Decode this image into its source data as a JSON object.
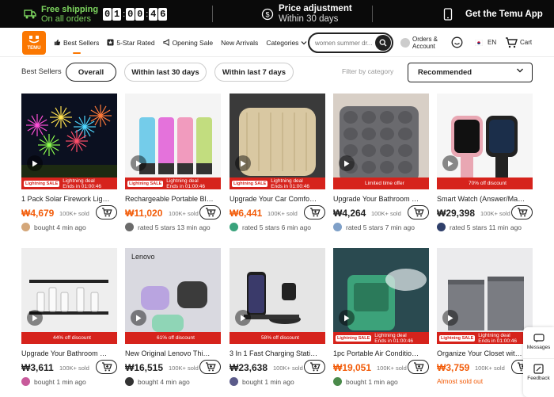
{
  "promo": {
    "shipping_title": "Free shipping",
    "shipping_sub": "On all orders",
    "timer": [
      "0",
      "1",
      "0",
      "0",
      "4",
      "6"
    ],
    "price_title": "Price adjustment",
    "price_sub": "Within 30 days",
    "app_label": "Get the Temu App"
  },
  "header": {
    "logo_text": "TEMU",
    "nav": [
      {
        "label": "Best Sellers",
        "icon": "thumbs-up-icon"
      },
      {
        "label": "5-Star Rated",
        "icon": "star-badge-icon"
      },
      {
        "label": "Opening Sale",
        "icon": "megaphone-icon"
      },
      {
        "label": "New Arrivals",
        "icon": ""
      },
      {
        "label": "Categories",
        "icon": "chevron-down-icon"
      }
    ],
    "search_placeholder": "women summer dr...",
    "orders_line1": "Orders &",
    "orders_line2": "Account",
    "lang": "EN",
    "cart": "Cart"
  },
  "filters": {
    "label": "Best Sellers",
    "options": [
      "Overall",
      "Within last 30 days",
      "Within last 7 days"
    ],
    "selected": "Overall",
    "category_label": "Filter by category",
    "sort": "Recommended"
  },
  "colors": {
    "accent": "#fb7701",
    "price": "#f25b08",
    "badge": "#d6231c"
  },
  "products": [
    {
      "title": "1 Pack Solar Firework Light ...",
      "price": "₩4,679",
      "sold": "100K+ sold",
      "badge_type": "lightning",
      "badge_line1": "Lightning deal",
      "badge_line2": "Ends in 01:00:46",
      "social": "bought 4 min ago",
      "img": "firework"
    },
    {
      "title": "Rechargeable Portable Blen...",
      "price": "₩11,020",
      "sold": "100K+ sold",
      "badge_type": "lightning",
      "badge_line1": "Lightning deal",
      "badge_line2": "Ends in 01:00:46",
      "social": "rated 5 stars 13 min ago",
      "img": "blender"
    },
    {
      "title": "Upgrade Your Car Comfort:...",
      "price": "₩6,441",
      "sold": "100K+ sold",
      "badge_type": "lightning",
      "badge_line1": "Lightning deal",
      "badge_line2": "Ends in 01:00:46",
      "social": "rated 5 stars 6 min ago",
      "img": "cushion"
    },
    {
      "title": "Upgrade Your Bathroom wit...",
      "price": "₩4,264",
      "sold": "100K+ sold",
      "badge_type": "plain",
      "badge_line1": "Limited time offer",
      "badge_line2": "",
      "social": "rated 5 stars 7 min ago",
      "img": "bathmat"
    },
    {
      "title": "Smart Watch (Answer/Make...",
      "price": "₩29,398",
      "sold": "100K+ sold",
      "badge_type": "plain",
      "badge_line1": "70% off discount",
      "badge_line2": "",
      "social": "rated 5 stars 11 min ago",
      "img": "watch"
    },
    {
      "title": "Upgrade Your Bathroom wit...",
      "price": "₩3,611",
      "sold": "100K+ sold",
      "badge_type": "plain",
      "badge_line1": "44% off discount",
      "badge_line2": "",
      "social": "bought 1 min ago",
      "img": "shelf"
    },
    {
      "title": "New Original Lenovo Think...",
      "price": "₩16,515",
      "sold": "100K+ sold",
      "badge_type": "plain",
      "badge_line1": "61% off discount",
      "badge_line2": "",
      "social": "bought 4 min ago",
      "img": "earbuds",
      "brand": "Lenovo"
    },
    {
      "title": "3 In 1 Fast Charging Station...",
      "price": "₩23,638",
      "sold": "100K+ sold",
      "badge_type": "plain",
      "badge_line1": "58% off discount",
      "badge_line2": "",
      "social": "bought 1 min ago",
      "img": "charger"
    },
    {
      "title": "1pc Portable Air Conditione...",
      "price": "₩19,051",
      "sold": "100K+ sold",
      "badge_type": "lightning",
      "badge_line1": "Lightning deal",
      "badge_line2": "Ends in 01:00:46",
      "social": "bought 1 min ago",
      "img": "aircon"
    },
    {
      "title": "Organize Your Closet with ...",
      "price": "₩3,759",
      "sold": "100K+ sold",
      "badge_type": "lightning",
      "badge_line1": "Lightning deal",
      "badge_line2": "Ends in 01:00:46",
      "social": "Almost sold out",
      "img": "storage"
    }
  ],
  "badge_xs": "Lightning SALE",
  "side": {
    "messages": "Messages",
    "feedback": "Feedback"
  }
}
